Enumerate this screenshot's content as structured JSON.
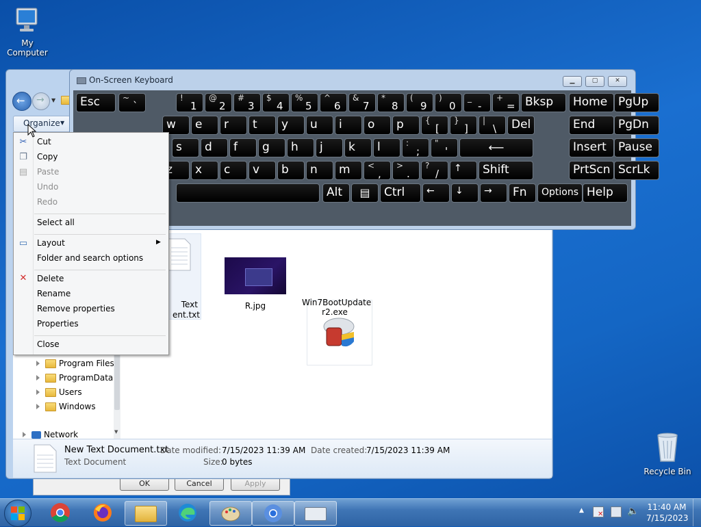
{
  "desktop": {
    "my_computer": "My Computer",
    "recycle_bin": "Recycle Bin"
  },
  "dialog_back": {
    "buttons": [
      "OK",
      "Cancel",
      "Apply"
    ]
  },
  "explorer": {
    "organize": "Organize",
    "nav_items": [
      "Program Files (",
      "ProgramData",
      "Users",
      "Windows"
    ],
    "network": "Network",
    "files": [
      {
        "name": "Text\nent.txt",
        "label_line1": "Text",
        "label_line2": "ent.txt"
      },
      {
        "label_line1": "R.jpg",
        "label_line2": ""
      },
      {
        "label_line1": "Win7BootUpdate",
        "label_line2": "r2.exe"
      }
    ],
    "details": {
      "filename": "New Text Document.txt",
      "type": "Text Document",
      "date_modified_label": "Date modified:",
      "date_modified": "7/15/2023 11:39 AM",
      "date_created_label": "Date created:",
      "date_created": "7/15/2023 11:39 AM",
      "size_label": "Size:",
      "size": "0 bytes"
    }
  },
  "context_menu": {
    "items": [
      {
        "label": "Cut",
        "enabled": true
      },
      {
        "label": "Copy",
        "enabled": true
      },
      {
        "label": "Paste",
        "enabled": false
      },
      {
        "label": "Undo",
        "enabled": false
      },
      {
        "label": "Redo",
        "enabled": false
      },
      {
        "label": "Select all",
        "enabled": true
      },
      {
        "label": "Layout",
        "enabled": true
      },
      {
        "label": "Folder and search options",
        "enabled": true
      },
      {
        "label": "Delete",
        "enabled": true
      },
      {
        "label": "Rename",
        "enabled": true
      },
      {
        "label": "Remove properties",
        "enabled": true
      },
      {
        "label": "Properties",
        "enabled": true
      },
      {
        "label": "Close",
        "enabled": true
      }
    ]
  },
  "osk": {
    "title": "On-Screen Keyboard",
    "rows": [
      [
        "Esc",
        "~ `",
        "! 1",
        "@ 2",
        "# 3",
        "$ 4",
        "% 5",
        "^ 6",
        "& 7",
        "* 8",
        "( 9",
        ") 0",
        "_ -",
        "+ =",
        "Bksp",
        "Home",
        "PgUp"
      ],
      [
        "w",
        "e",
        "r",
        "t",
        "y",
        "u",
        "i",
        "o",
        "p",
        "{ [",
        "} ]",
        "| \\",
        "Del",
        "End",
        "PgDn"
      ],
      [
        "s",
        "d",
        "f",
        "g",
        "h",
        "j",
        "k",
        "l",
        ": ;",
        "\" '",
        "Enter",
        "Insert",
        "Pause"
      ],
      [
        "z",
        "x",
        "c",
        "v",
        "b",
        "n",
        "m",
        "< ,",
        "> .",
        "? /",
        "↑",
        "Shift",
        "PrtScn",
        "ScrLk"
      ],
      [
        "Space",
        "Alt",
        "Menu",
        "Ctrl",
        "←",
        "↓",
        "→",
        "Fn",
        "Options",
        "Help"
      ]
    ],
    "labels": {
      "esc": "Esc",
      "bksp": "Bksp",
      "home": "Home",
      "pgup": "PgUp",
      "del": "Del",
      "end": "End",
      "pgdn": "PgDn",
      "insert": "Insert",
      "pause": "Pause",
      "shift": "Shift",
      "prtscn": "PrtScn",
      "scrlk": "ScrLk",
      "alt": "Alt",
      "ctrl": "Ctrl",
      "fn": "Fn",
      "options": "Options",
      "help": "Help"
    }
  },
  "taskbar": {
    "time": "11:40 AM",
    "date": "7/15/2023"
  }
}
